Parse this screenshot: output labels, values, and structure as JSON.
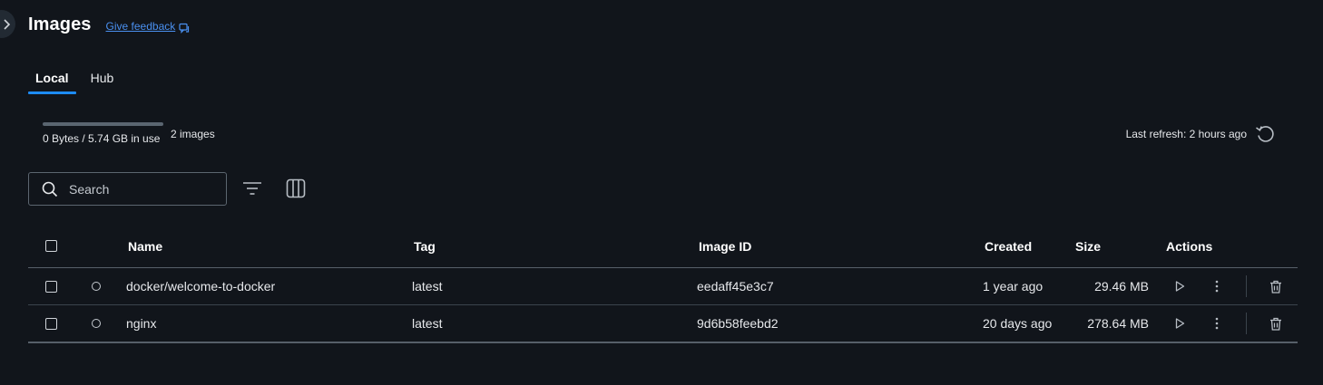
{
  "header": {
    "title": "Images",
    "feedback_label": "Give feedback"
  },
  "tabs": [
    {
      "label": "Local",
      "active": true
    },
    {
      "label": "Hub",
      "active": false
    }
  ],
  "usage": {
    "text": "0 Bytes / 5.74 GB in use",
    "count_text": "2 images",
    "fraction_used": 0
  },
  "refresh": {
    "text": "Last refresh: 2 hours ago"
  },
  "search": {
    "placeholder": "Search",
    "value": ""
  },
  "icons": {
    "collapse": "chevron-right-icon",
    "feedback": "feedback-icon",
    "refresh": "refresh-icon",
    "search": "search-icon",
    "filter": "filter-icon",
    "columns": "columns-icon",
    "run": "play-icon",
    "more": "more-vertical-icon",
    "delete": "trash-icon"
  },
  "table": {
    "columns": {
      "name": "Name",
      "tag": "Tag",
      "image_id": "Image ID",
      "created": "Created",
      "size": "Size",
      "actions": "Actions"
    },
    "rows": [
      {
        "name": "docker/welcome-to-docker",
        "tag": "latest",
        "image_id": "eedaff45e3c7",
        "created": "1 year ago",
        "size": "29.46 MB"
      },
      {
        "name": "nginx",
        "tag": "latest",
        "image_id": "9d6b58feebd2",
        "created": "20 days ago",
        "size": "278.64 MB"
      }
    ]
  },
  "colors": {
    "background": "#11151b",
    "accent": "#1d8cf8",
    "link": "#4a90f0"
  }
}
